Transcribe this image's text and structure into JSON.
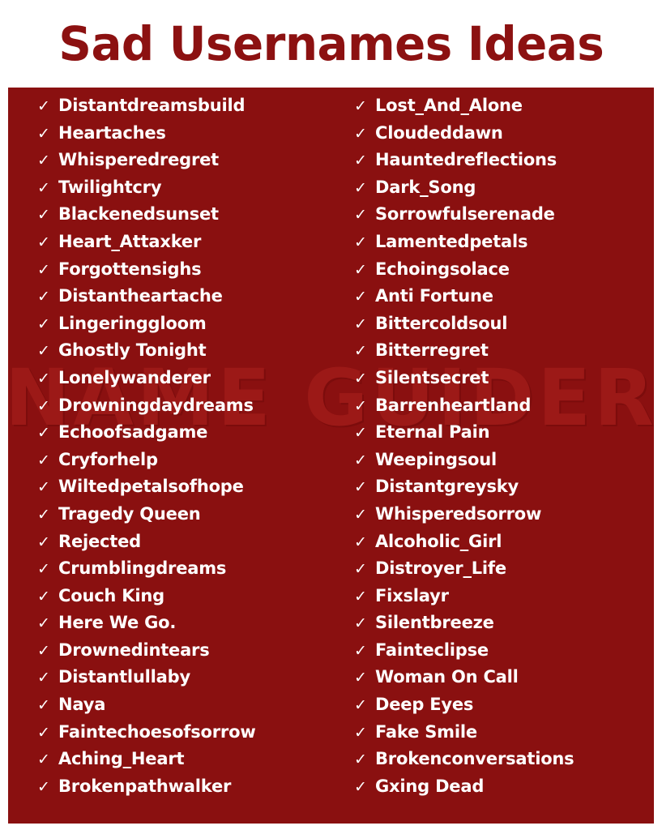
{
  "header": {
    "title": "Sad Usernames Ideas"
  },
  "watermark": {
    "text": "NAME GUIDER"
  },
  "colors": {
    "panel_background": "#8A1010",
    "title_text": "#8C1111",
    "item_text": "#FFFFFF",
    "watermark": "#9E1A18",
    "page_background": "#FFFFFF"
  },
  "bullet": {
    "icon": "check-icon",
    "glyph": "✓"
  },
  "columns": [
    {
      "name": "left-column",
      "items": [
        "Distantdreamsbuild",
        "Heartaches",
        "Whisperedregret",
        "Twilightcry",
        "Blackenedsunset",
        "Heart_Attaxker",
        "Forgottensighs",
        "Distantheartache",
        "Lingeringgloom",
        "Ghostly Tonight",
        "Lonelywanderer",
        "Drowningdaydreams",
        "Echoofsadgame",
        "Cryforhelp",
        "Wiltedpetalsofhope",
        "Tragedy Queen",
        "Rejected",
        "Crumblingdreams",
        "Couch King",
        "Here We Go.",
        "Drownedintears",
        "Distantlullaby",
        "Naya",
        "Faintechoesofsorrow",
        "Aching_Heart",
        "Brokenpathwalker"
      ]
    },
    {
      "name": "right-column",
      "items": [
        "Lost_And_Alone",
        "Cloudeddawn",
        "Hauntedreflections",
        "Dark_Song",
        "Sorrowfulserenade",
        "Lamentedpetals",
        "Echoingsolace",
        "Anti Fortune",
        "Bittercoldsoul",
        "Bitterregret",
        "Silentsecret",
        "Barrenheartland",
        "Eternal Pain",
        "Weepingsoul",
        "Distantgreysky",
        "Whisperedsorrow",
        "Alcoholic_Girl",
        "Distroyer_Life",
        "Fixslayr",
        "Silentbreeze",
        "Fainteclipse",
        "Woman On Call",
        "Deep Eyes",
        "Fake Smile",
        "Brokenconversations",
        "Gxing Dead"
      ]
    }
  ]
}
